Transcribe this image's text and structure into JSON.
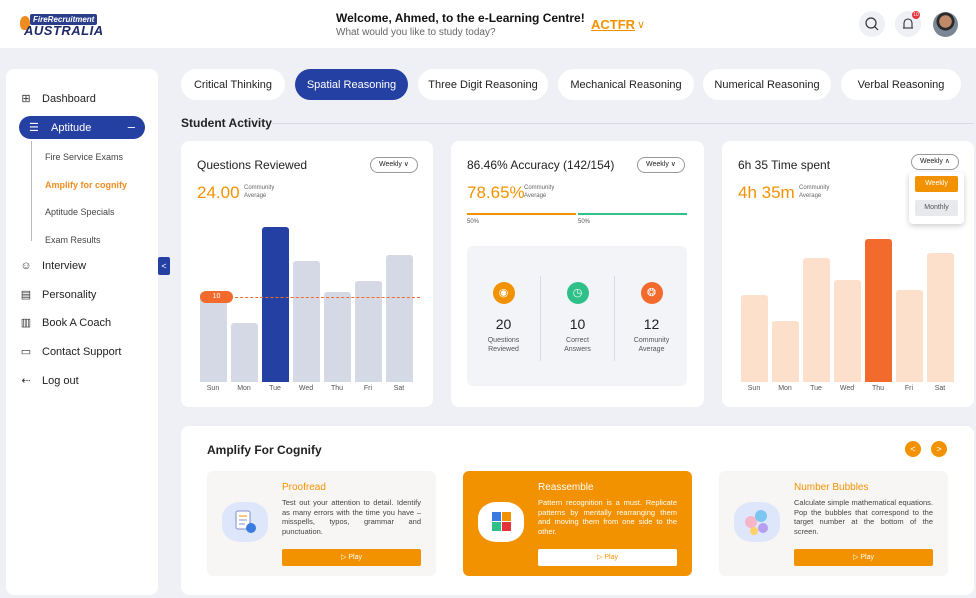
{
  "header": {
    "logo_small": "FireRecruitment",
    "logo_main": "AUSTRALIA",
    "welcome_title": "Welcome, Ahmed, to the e-Learning Centre!",
    "welcome_sub": "What would you like to study today?",
    "org": "ACTFR",
    "notif_count": "10"
  },
  "sidebar": {
    "items": [
      {
        "label": "Dashboard"
      },
      {
        "label": "Aptitude"
      },
      {
        "label": "Interview"
      },
      {
        "label": "Personality"
      },
      {
        "label": "Book A Coach"
      },
      {
        "label": "Contact Support"
      },
      {
        "label": "Log out"
      }
    ],
    "sub_items": [
      {
        "label": "Fire Service Exams"
      },
      {
        "label": "Amplify for cognify"
      },
      {
        "label": "Aptitude Specials"
      },
      {
        "label": "Exam Results"
      }
    ]
  },
  "tabs": [
    {
      "label": "Critical Thinking"
    },
    {
      "label": "Spatial Reasoning"
    },
    {
      "label": "Three Digit Reasoning"
    },
    {
      "label": "Mechanical Reasoning"
    },
    {
      "label": "Numerical Reasoning"
    },
    {
      "label": "Verbal Reasoning"
    }
  ],
  "section_title": "Student Activity",
  "cards": {
    "questions": {
      "title": "Questions Reviewed",
      "dropdown": "Weekly",
      "big_value": "24.00",
      "ca_line1": "Community",
      "ca_line2": "Average",
      "marker": "10"
    },
    "accuracy": {
      "title": "86.46% Accuracy (142/154)",
      "dropdown": "Weekly",
      "big_value": "78.65%",
      "ca_line1": "Community",
      "ca_line2": "Average",
      "p1": "50%",
      "p2": "50%",
      "stats": [
        {
          "num": "20",
          "l1": "Questions",
          "l2": "Reviewed"
        },
        {
          "num": "10",
          "l1": "Correct",
          "l2": "Answers"
        },
        {
          "num": "12",
          "l1": "Community",
          "l2": "Average"
        }
      ]
    },
    "time": {
      "title": "6h 35 Time spent",
      "dropdown": "Weekly",
      "big_value": "4h 35m",
      "ca_line1": "Community",
      "ca_line2": "Average",
      "options": [
        "Weekly",
        "Monthly"
      ]
    }
  },
  "days": [
    "Sun",
    "Mon",
    "Tue",
    "Wed",
    "Thu",
    "Fri",
    "Sat"
  ],
  "chart_data": [
    {
      "type": "bar",
      "categories": [
        "Sun",
        "Mon",
        "Tue",
        "Wed",
        "Thu",
        "Fri",
        "Sat"
      ],
      "values": [
        58,
        38,
        100,
        78,
        58,
        65,
        82
      ],
      "highlight": "Tue",
      "reference_line": 10
    },
    {
      "type": "bar",
      "categories": [
        "Sun",
        "Mon",
        "Tue",
        "Wed",
        "Thu",
        "Fri",
        "Sat"
      ],
      "values": [
        61,
        43,
        87,
        71,
        100,
        64,
        90
      ],
      "highlight": "Thu"
    }
  ],
  "amplify": {
    "title": "Amplify For Cognify",
    "games": [
      {
        "title": "Proofread",
        "desc": "Test out your attention to detail. Identify as many errors with the time you have – misspells, typos, grammar and punctuation.",
        "play": "▷  Play"
      },
      {
        "title": "Reassemble",
        "desc": "Pattern recognition is a must. Replicate patterns by mentally rearranging them and moving them from one side to the other.",
        "play": "▷  Play"
      },
      {
        "title": "Number Bubbles",
        "desc": "Calculate simple mathematical equations. Pop the bubbles that correspond to the target number at the bottom of the screen.",
        "play": "▷  Play"
      }
    ]
  },
  "colors": {
    "primary": "#2540a3",
    "accent": "#f39200",
    "accent_light": "#fde0cc",
    "bar_gray": "#d5d9e6"
  }
}
